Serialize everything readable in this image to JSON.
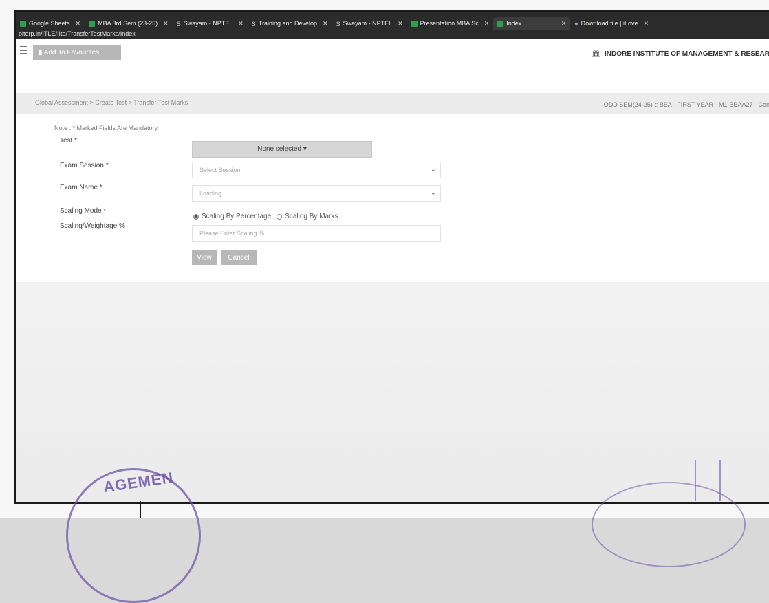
{
  "browser": {
    "tabs": [
      {
        "label": "Google Sheets",
        "icon": "sheets-icon"
      },
      {
        "label": "MBA 3rd Sem (23-25)",
        "icon": "sheets-icon"
      },
      {
        "label": "Swayam - NPTEL",
        "icon": "swayam-icon"
      },
      {
        "label": "Training and Develop",
        "icon": "swayam-icon"
      },
      {
        "label": "Swayam - NPTEL",
        "icon": "swayam-icon"
      },
      {
        "label": "Presentation MBA Sc",
        "icon": "sheets-icon"
      },
      {
        "label": "Index",
        "icon": "sheets-icon"
      },
      {
        "label": "Download file | iLove",
        "icon": "download-icon"
      }
    ],
    "url": "olterp.in/ITLE/IIte/TransferTestMarks/Index"
  },
  "header": {
    "add_favourites": "Add To Favourites",
    "institute": "INDORE INSTITUTE OF MANAGEMENT & RESEAR"
  },
  "breadcrumb": "Global Assessment > Create Test > Transfer Test Marks",
  "session_info": "ODD SEM(24-25) :: BBA - FIRST YEAR - M1-BBAA27 - Con",
  "form": {
    "note": "Note : * Marked Fields Are Mandatory",
    "test_label": "Test *",
    "test_value": "None selected",
    "exam_session_label": "Exam Session *",
    "exam_session_placeholder": "Select Session",
    "exam_name_label": "Exam Name *",
    "exam_name_value": "Loading",
    "scaling_mode_label": "Scaling Mode *",
    "scaling_percentage": "Scaling By Percentage",
    "scaling_marks": "Scaling By Marks",
    "scaling_weightage_label": "Scaling/Weightage %",
    "scaling_weightage_placeholder": "Please Enter Scaling %",
    "view_label": "View",
    "cancel_label": "Cancel"
  },
  "stamp": {
    "text": "AGEMEN"
  },
  "colors": {
    "tabbar": "#2b2b2b",
    "button": "#b7b7b7",
    "stamp": "#6c56a8"
  }
}
